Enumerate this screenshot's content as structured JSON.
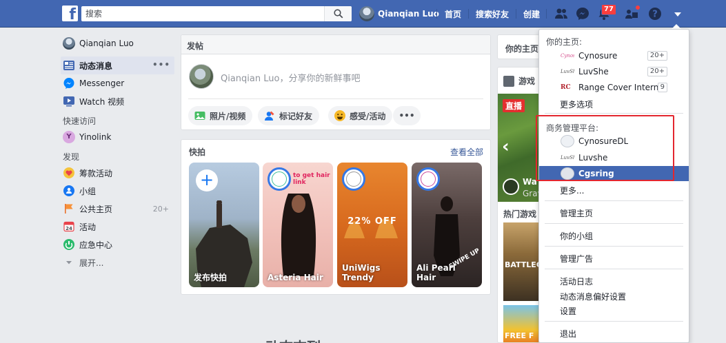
{
  "topbar": {
    "logo": "f",
    "search_placeholder": "搜索",
    "user_name": "Qianqian Luo",
    "nav": [
      "首页",
      "搜索好友",
      "创建"
    ],
    "notification_count": "77"
  },
  "left_nav": {
    "user": "Qianqian Luo",
    "items": [
      {
        "label": "动态消息",
        "more": "•••"
      },
      {
        "label": "Messenger"
      },
      {
        "label": "Watch 视频"
      }
    ],
    "shortcuts_heading": "快速访问",
    "shortcuts": [
      {
        "label": "Yinolink",
        "initial": "Y"
      }
    ],
    "explore_heading": "发现",
    "explore": [
      {
        "label": "筹款活动"
      },
      {
        "label": "小组"
      },
      {
        "label": "公共主页",
        "count": "20+"
      },
      {
        "label": "活动"
      },
      {
        "label": "应急中心"
      }
    ],
    "expand": "展开..."
  },
  "composer": {
    "title": "发帖",
    "prompt": "Qianqian Luo，分享你的新鲜事吧",
    "actions": [
      "照片/视频",
      "标记好友",
      "感受/活动"
    ],
    "more": "•••"
  },
  "stories": {
    "title": "快拍",
    "see_all": "查看全部",
    "items": [
      {
        "label": "发布快拍"
      },
      {
        "label": "Asteria Hair",
        "tag": "to get hair link"
      },
      {
        "label": "UniWigs Trendy",
        "line1": "UniWigs",
        "line2": "Trendy",
        "offer": "22% OFF"
      },
      {
        "label": "Ali Pearl Hair",
        "tag": "SWIPE UP"
      }
    ]
  },
  "right": {
    "pages_title": "你的主页",
    "games_title": "游戏",
    "live": "直播",
    "live_caption1": "Wa",
    "live_caption2": "Grav",
    "hot_games": "热门游戏",
    "game1_text": "BATTLEGRO",
    "game2_text": "FREE F"
  },
  "bottom_text": "动态吉列",
  "dropdown": {
    "your_pages_heading": "你的主页:",
    "pages": [
      {
        "name": "Cynosure",
        "count": "20+",
        "logo": "Cynosure"
      },
      {
        "name": "LuvShe",
        "count": "20+",
        "logo": "LuvShe"
      },
      {
        "name": "Range Cover Interna...",
        "count": "9",
        "logo": "RC"
      }
    ],
    "more_options": "更多选项",
    "business_heading": "商务管理平台:",
    "businesses": [
      {
        "name": "CynosureDL"
      },
      {
        "name": "Luvshe",
        "logo": "LuvShe"
      },
      {
        "name": "Cgsring"
      }
    ],
    "more": "更多...",
    "manage_pages": "管理主页",
    "your_groups": "你的小组",
    "manage_ads": "管理广告",
    "activity_log": "活动日志",
    "news_feed_prefs": "动态消息偏好设置",
    "settings": "设置",
    "logout": "退出"
  },
  "colors": {
    "brand": "#4267b2",
    "selected": "#4267b2",
    "highlight_box": "#e3262e",
    "badge": "#fa3e3e"
  }
}
